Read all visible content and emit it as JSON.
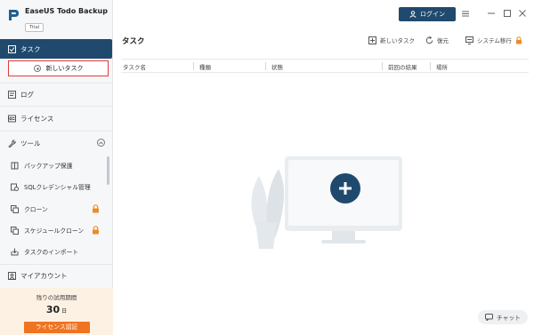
{
  "app": {
    "name": "EaseUS Todo Backup",
    "edition_badge": "Trial"
  },
  "sidebar": {
    "task": "タスク",
    "new_task": "新しいタスク",
    "log": "ログ",
    "license": "ライセンス",
    "tools": "ツール",
    "tool_items": [
      {
        "label": "パックアップ保護",
        "icon": "shield-icon",
        "locked": false
      },
      {
        "label": "SQLクレデンシャル管理",
        "icon": "database-icon",
        "locked": false
      },
      {
        "label": "クローン",
        "icon": "clone-icon",
        "locked": true
      },
      {
        "label": "スケジュールクローン",
        "icon": "schedule-clone-icon",
        "locked": true
      },
      {
        "label": "タスクのインポート",
        "icon": "import-icon",
        "locked": false
      }
    ],
    "my_account": "マイアカウント",
    "trial_remaining_label": "残りの試用期間",
    "trial_days": "30",
    "trial_days_unit": "日",
    "license_button": "ライセンス認証"
  },
  "header": {
    "login": "ログイン"
  },
  "main": {
    "title": "タスク",
    "toolbar": {
      "new_task": "新しいタスク",
      "restore": "復元",
      "system_transfer": "システム移行"
    },
    "columns": [
      "タスク名",
      "種類",
      "状態",
      "前回の結果",
      "場所"
    ]
  },
  "chat": {
    "label": "チャット"
  },
  "colors": {
    "primary": "#1f4a6d",
    "highlight_border": "#e03b3b",
    "license_button": "#f07320",
    "trial_panel_bg": "#fdf1e3",
    "lock": "#f08a24"
  }
}
